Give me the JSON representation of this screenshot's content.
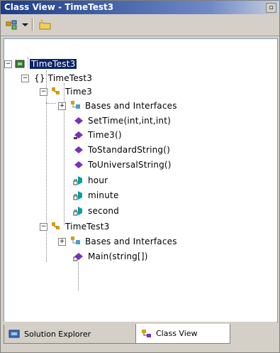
{
  "window": {
    "title": "Class View - TimeTest3"
  },
  "toolbar": {
    "sort_icon": "sort-icon",
    "dropdown_icon": "chevron-down-icon",
    "folder_icon": "new-folder-icon"
  },
  "tree": {
    "solution": "TimeTest3",
    "namespace": "{} TimeTest3",
    "class_time3": "Time3",
    "bases": "Bases and Interfaces",
    "m_settime": "SetTime(int,int,int)",
    "m_ctor": "Time3()",
    "m_tostandard": "ToStandardString()",
    "m_touniversal": "ToUniversalString()",
    "f_hour": "hour",
    "f_minute": "minute",
    "f_second": "second",
    "class_timetest3": "TimeTest3",
    "bases2": "Bases and Interfaces",
    "m_main": "Main(string[])"
  },
  "tabs": {
    "solution_explorer": "Solution Explorer",
    "class_view": "Class View"
  },
  "colors": {
    "selection": "#0a246a",
    "method": "#7b2fbf",
    "field": "#00a0a0",
    "class": "#d4a000"
  }
}
